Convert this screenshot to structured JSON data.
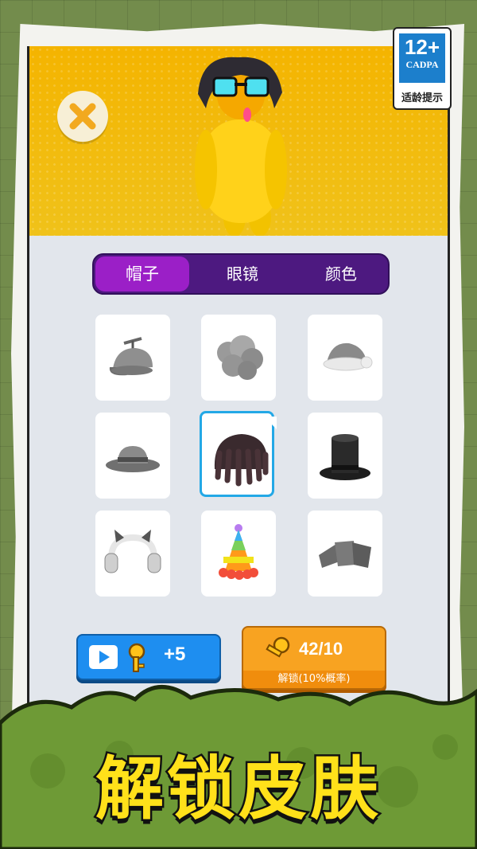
{
  "rating": {
    "age": "12+",
    "org": "CADPA",
    "hint": "适龄提示"
  },
  "tabs": [
    {
      "label": "帽子",
      "active": true
    },
    {
      "label": "眼镜",
      "active": false
    },
    {
      "label": "颜色",
      "active": false
    }
  ],
  "items": [
    {
      "name": "propeller-cap",
      "selected": false
    },
    {
      "name": "curly-wig",
      "selected": false
    },
    {
      "name": "santa-hat",
      "selected": false
    },
    {
      "name": "fedora",
      "selected": false
    },
    {
      "name": "dreadlocks",
      "selected": true
    },
    {
      "name": "top-hat",
      "selected": false
    },
    {
      "name": "cat-ear-headphones",
      "selected": false
    },
    {
      "name": "party-hat",
      "selected": false
    },
    {
      "name": "cardboard",
      "selected": false
    }
  ],
  "buttons": {
    "video_reward": "+5",
    "unlock_keys": "42/10",
    "unlock_label": "解锁(10%概率)"
  },
  "banner": "解锁皮肤",
  "colors": {
    "accent_purple": "#9b1fc7",
    "hero_yellow": "#f4b400",
    "select_blue": "#23a8e6"
  }
}
